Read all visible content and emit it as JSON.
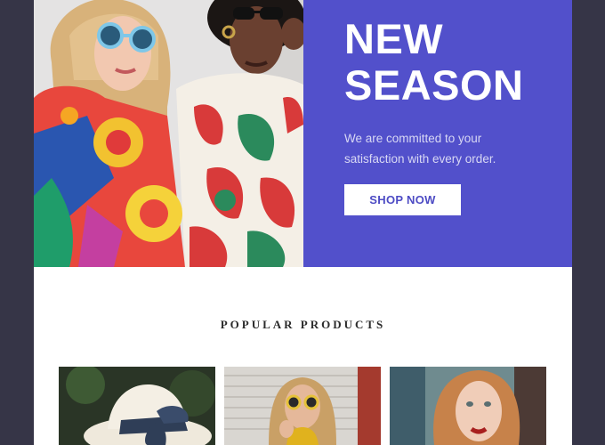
{
  "hero": {
    "title_line1": "NEW",
    "title_line2": "SEASON",
    "description": "We are committed to your satisfaction with every order.",
    "cta_label": "SHOP NOW"
  },
  "products_section": {
    "title": "POPULAR PRODUCTS"
  },
  "colors": {
    "page_background": "#363547",
    "hero_panel": "#5250cb",
    "button_text": "#4d4bc4"
  }
}
